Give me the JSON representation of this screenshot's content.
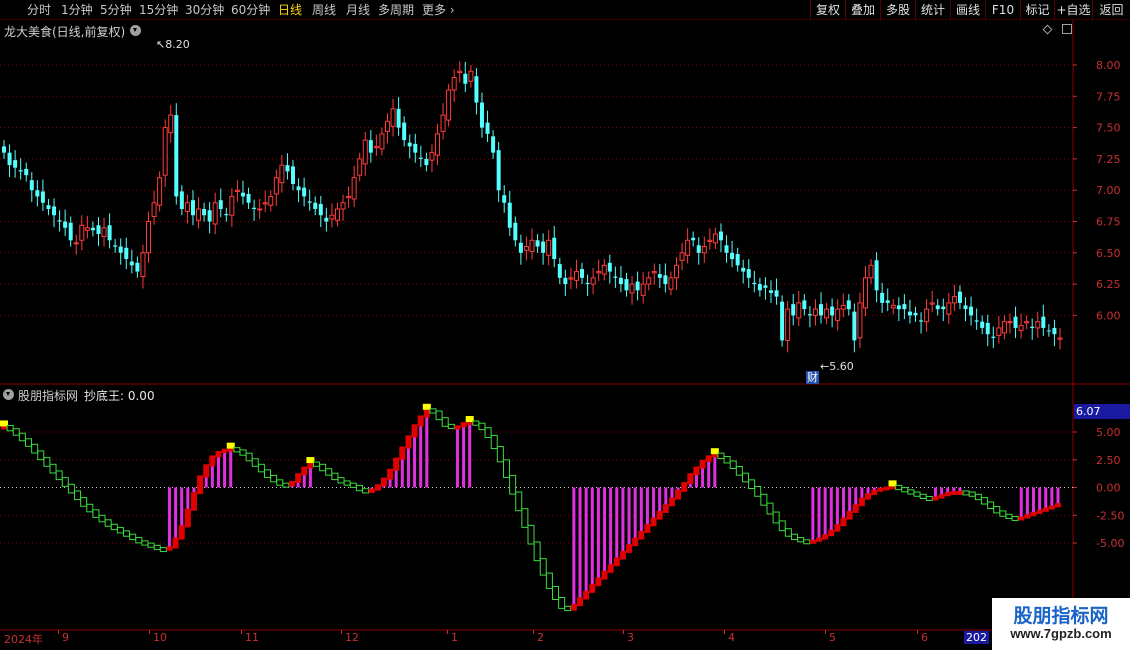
{
  "toolbar": {
    "periods": [
      "分时",
      "1分钟",
      "5分钟",
      "15分钟",
      "30分钟",
      "60分钟",
      "日线",
      "周线",
      "月线",
      "多周期",
      "更多"
    ],
    "active_period": "日线",
    "buttons": [
      "复权",
      "叠加",
      "多股",
      "统计",
      "画线",
      "F10",
      "标记",
      "+自选",
      "返回"
    ]
  },
  "main_panel": {
    "title": "龙大美食(日线,前复权)",
    "price_axis": [
      "8.00",
      "7.75",
      "7.50",
      "7.25",
      "7.00",
      "6.75",
      "6.50",
      "6.25",
      "6.00"
    ],
    "high_marker": "8.20",
    "low_marker": "5.60",
    "event_badge": "财"
  },
  "indicator_panel": {
    "title": "股朋指标网",
    "value_label": "抄底王: 0.00",
    "current_value_tag": "6.07",
    "axis": [
      "5.00",
      "2.50",
      "0.00",
      "-2.50",
      "-5.00"
    ]
  },
  "x_axis": {
    "year_label": "2024年",
    "months": [
      "9",
      "10",
      "11",
      "12",
      "1",
      "2",
      "3",
      "4",
      "5",
      "6"
    ],
    "next_year_label": "202"
  },
  "watermark": {
    "line1": "股朋指标网",
    "line2": "www.7gpzb.com"
  },
  "colors": {
    "up": "#ff3c3c",
    "down": "#54ffff",
    "indicator_green": "#3cdc3c",
    "indicator_red": "#e00000",
    "indicator_magenta": "#e030e0",
    "indicator_yellow": "#ffff00",
    "grid": "#8c0000"
  },
  "price_series": {
    "close": [
      7.3,
      7.2,
      7.18,
      7.15,
      7.12,
      7.0,
      6.95,
      6.9,
      6.85,
      6.8,
      6.75,
      6.7,
      6.6,
      6.58,
      6.72,
      6.7,
      6.68,
      6.65,
      6.7,
      6.6,
      6.55,
      6.5,
      6.45,
      6.4,
      6.35,
      6.5,
      6.75,
      6.9,
      7.1,
      7.5,
      7.6,
      6.95,
      6.85,
      6.9,
      6.8,
      6.85,
      6.8,
      6.75,
      6.9,
      6.85,
      6.8,
      6.95,
      7.0,
      6.95,
      6.9,
      6.85,
      6.85,
      6.9,
      6.95,
      7.1,
      7.2,
      7.15,
      7.05,
      7.0,
      6.95,
      6.9,
      6.85,
      6.8,
      6.75,
      6.8,
      6.85,
      6.9,
      6.95,
      7.1,
      7.25,
      7.4,
      7.3,
      7.35,
      7.45,
      7.55,
      7.65,
      7.5,
      7.4,
      7.35,
      7.3,
      7.25,
      7.2,
      7.3,
      7.45,
      7.6,
      7.8,
      7.9,
      7.95,
      7.85,
      7.95,
      7.7,
      7.5,
      7.45,
      7.3,
      7.0,
      6.9,
      6.7,
      6.6,
      6.5,
      6.55,
      6.6,
      6.55,
      6.5,
      6.6,
      6.45,
      6.3,
      6.25,
      6.3,
      6.35,
      6.3,
      6.25,
      6.3,
      6.35,
      6.4,
      6.35,
      6.3,
      6.25,
      6.2,
      6.25,
      6.2,
      6.25,
      6.3,
      6.35,
      6.3,
      6.25,
      6.3,
      6.4,
      6.5,
      6.6,
      6.6,
      6.5,
      6.55,
      6.6,
      6.65,
      6.6,
      6.5,
      6.45,
      6.4,
      6.35,
      6.3,
      6.25,
      6.2,
      6.22,
      6.18,
      6.15,
      5.8,
      6.05,
      6.0,
      6.1,
      6.05,
      6.0,
      6.05,
      6.0,
      6.05,
      6.0,
      6.05,
      6.08,
      6.05,
      5.8,
      6.1,
      6.3,
      6.4,
      6.2,
      6.1,
      6.1,
      6.08,
      6.05,
      6.05,
      6.0,
      6.0,
      5.95,
      6.05,
      6.1,
      6.05,
      6.05,
      6.1,
      6.15,
      6.1,
      6.05,
      6.0,
      5.95,
      5.9,
      5.85,
      5.82,
      5.9,
      5.95,
      5.95,
      5.9,
      5.92,
      5.95,
      5.9,
      5.95,
      5.9,
      5.88,
      5.85,
      5.82
    ]
  },
  "indicator_series": {
    "values": [
      5.5,
      5.2,
      4.8,
      4.3,
      3.8,
      3.2,
      2.6,
      2.0,
      1.4,
      0.8,
      0.2,
      -0.4,
      -1.0,
      -1.6,
      -2.1,
      -2.6,
      -3.0,
      -3.4,
      -3.7,
      -4.0,
      -4.3,
      -4.6,
      -4.9,
      -5.1,
      -5.3,
      -5.5,
      -5.6,
      -5.4,
      -4.6,
      -3.5,
      -2.0,
      -0.5,
      1.0,
      2.0,
      2.8,
      3.2,
      3.4,
      3.5,
      3.3,
      3.0,
      2.5,
      2.0,
      1.5,
      1.0,
      0.6,
      0.3,
      0.2,
      0.5,
      1.2,
      1.8,
      2.2,
      2.0,
      1.6,
      1.2,
      0.8,
      0.5,
      0.3,
      0.1,
      -0.2,
      -0.4,
      -0.2,
      0.2,
      0.8,
      1.6,
      2.6,
      3.6,
      4.6,
      5.6,
      6.4,
      7.0,
      6.8,
      6.2,
      5.6,
      5.4,
      5.5,
      5.8,
      5.9,
      5.7,
      5.3,
      4.6,
      3.6,
      2.4,
      1.0,
      -0.5,
      -2.0,
      -3.5,
      -5.0,
      -6.5,
      -7.8,
      -9.0,
      -10.0,
      -10.8,
      -11.0,
      -10.6,
      -10.0,
      -9.4,
      -8.8,
      -8.2,
      -7.6,
      -7.0,
      -6.4,
      -5.8,
      -5.2,
      -4.6,
      -4.0,
      -3.4,
      -2.8,
      -2.2,
      -1.6,
      -1.0,
      -0.3,
      0.4,
      1.2,
      1.8,
      2.4,
      2.8,
      3.0,
      2.7,
      2.3,
      1.8,
      1.2,
      0.6,
      0.0,
      -0.7,
      -1.5,
      -2.3,
      -3.1,
      -3.8,
      -4.3,
      -4.6,
      -4.8,
      -4.9,
      -4.8,
      -4.6,
      -4.3,
      -3.9,
      -3.4,
      -2.8,
      -2.2,
      -1.6,
      -1.0,
      -0.6,
      -0.3,
      -0.1,
      0.0,
      0.1,
      -0.1,
      -0.3,
      -0.5,
      -0.7,
      -0.9,
      -1.0,
      -0.9,
      -0.7,
      -0.5,
      -0.4,
      -0.4,
      -0.5,
      -0.7,
      -1.0,
      -1.4,
      -1.8,
      -2.2,
      -2.5,
      -2.7,
      -2.8,
      -2.7,
      -2.5,
      -2.3,
      -2.1,
      -1.9,
      -1.7,
      -1.5
    ]
  }
}
